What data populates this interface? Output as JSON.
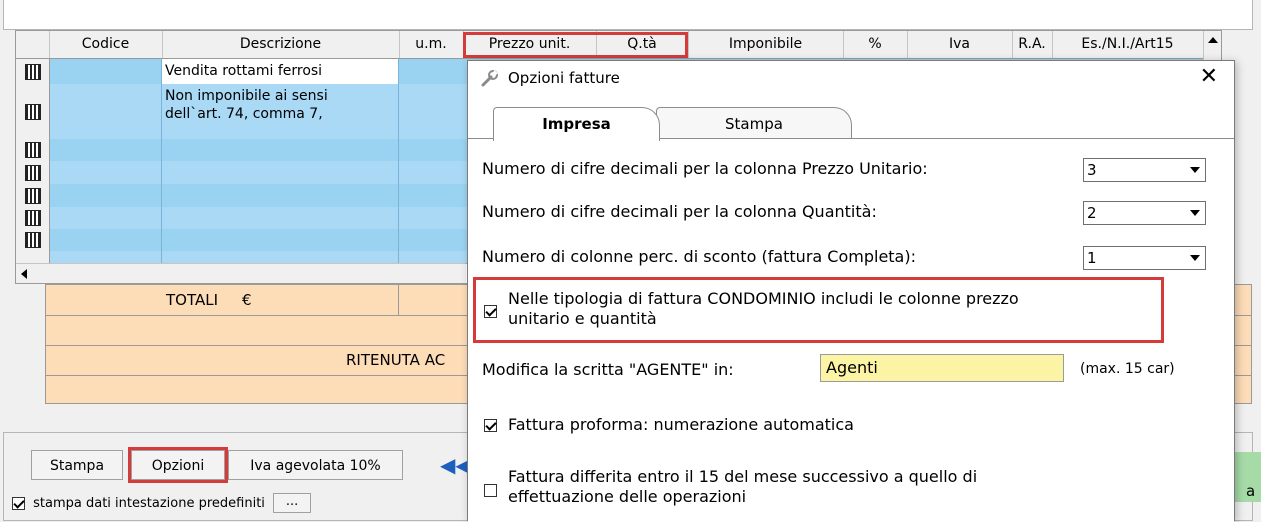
{
  "grid": {
    "headers": [
      "Codice",
      "Descrizione",
      "u.m.",
      "Prezzo unit.",
      "Q.tà",
      "Imponibile",
      "%",
      "Iva",
      "R.A.",
      "Es./N.I./Art15"
    ],
    "rows": [
      {
        "description": "Vendita rottami ferrosi"
      },
      {
        "description_line1": "Non imponibile ai sensi",
        "description_line2": "dell`art. 74, comma 7,"
      }
    ]
  },
  "totals": {
    "totali_label": "TOTALI",
    "currency": "€",
    "ritenuta_label": "RITENUTA AC"
  },
  "bottom": {
    "stampa_button": "Stampa",
    "opzioni_button": "Opzioni",
    "iva_button": "Iva agevolata 10%",
    "nav_icon": "◀◀",
    "stampa_dati_label": "stampa dati intestazione predefiniti",
    "ellipsis_button": "...",
    "right_edge_text": "a"
  },
  "dialog": {
    "title": "Opzioni fatture",
    "close_glyph": "✕",
    "tabs": [
      "Impresa",
      "Stampa"
    ],
    "options": {
      "prezzo_label": "Numero di cifre decimali per la colonna Prezzo Unitario:",
      "prezzo_value": "3",
      "quantita_label": "Numero di cifre decimali per la colonna Quantità:",
      "quantita_value": "2",
      "sconto_label": "Numero di colonne perc. di sconto (fattura Completa):",
      "sconto_value": "1",
      "condominio_line1": "Nelle tipologia di fattura CONDOMINIO includi le colonne prezzo",
      "condominio_line2": "unitario e quantità",
      "agente_label": "Modifica la scritta \"AGENTE\" in:",
      "agente_value": "Agenti",
      "agente_hint": "(max. 15 car)",
      "proforma_label": "Fattura proforma: numerazione automatica",
      "differita_line1": "Fattura differita entro il 15 del mese successivo a quello di",
      "differita_line2": "effettuazione delle operazioni"
    },
    "checked": {
      "condominio": true,
      "proforma": true,
      "differita": false
    }
  }
}
